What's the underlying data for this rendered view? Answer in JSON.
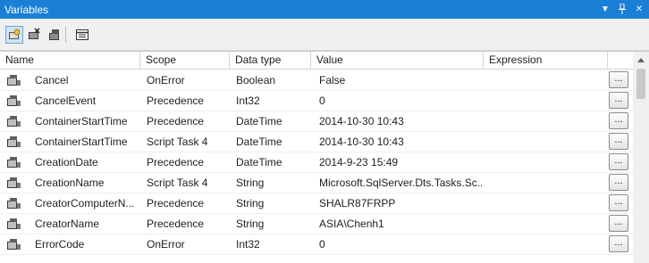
{
  "window": {
    "title": "Variables",
    "controls": [
      "dropdown-icon",
      "pin-icon",
      "close-icon"
    ]
  },
  "toolbar": {
    "buttons": [
      {
        "name": "add-variable-button",
        "icon": "add-variable-icon"
      },
      {
        "name": "delete-variable-button",
        "icon": "delete-variable-icon"
      },
      {
        "name": "show-all-variables-button",
        "icon": "show-all-variables-icon"
      },
      {
        "name": "grid-options-button",
        "icon": "grid-options-icon"
      }
    ]
  },
  "grid": {
    "columns": [
      "Name",
      "Scope",
      "Data type",
      "Value",
      "Expression"
    ],
    "expression_button_label": "...",
    "rows": [
      {
        "name": "Cancel",
        "scope": "OnError",
        "type": "Boolean",
        "value": "False",
        "expression": ""
      },
      {
        "name": "CancelEvent",
        "scope": "Precedence",
        "type": "Int32",
        "value": "0",
        "expression": ""
      },
      {
        "name": "ContainerStartTime",
        "scope": "Precedence",
        "type": "DateTime",
        "value": "2014-10-30 10:43",
        "expression": ""
      },
      {
        "name": "ContainerStartTime",
        "scope": "Script Task 4",
        "type": "DateTime",
        "value": "2014-10-30 10:43",
        "expression": ""
      },
      {
        "name": "CreationDate",
        "scope": "Precedence",
        "type": "DateTime",
        "value": "2014-9-23 15:49",
        "expression": ""
      },
      {
        "name": "CreationName",
        "scope": "Script Task 4",
        "type": "String",
        "value": "Microsoft.SqlServer.Dts.Tasks.Sc...",
        "expression": ""
      },
      {
        "name": "CreatorComputerN...",
        "scope": "Precedence",
        "type": "String",
        "value": "SHALR87FRPP",
        "expression": ""
      },
      {
        "name": "CreatorName",
        "scope": "Precedence",
        "type": "String",
        "value": "ASIA\\Chenh1",
        "expression": ""
      },
      {
        "name": "ErrorCode",
        "scope": "OnError",
        "type": "Int32",
        "value": "0",
        "expression": ""
      }
    ]
  },
  "colors": {
    "titlebar": "#1c7fd6",
    "toolbar": "#f0f0f0",
    "grid_lines": "#d5d5d5"
  }
}
